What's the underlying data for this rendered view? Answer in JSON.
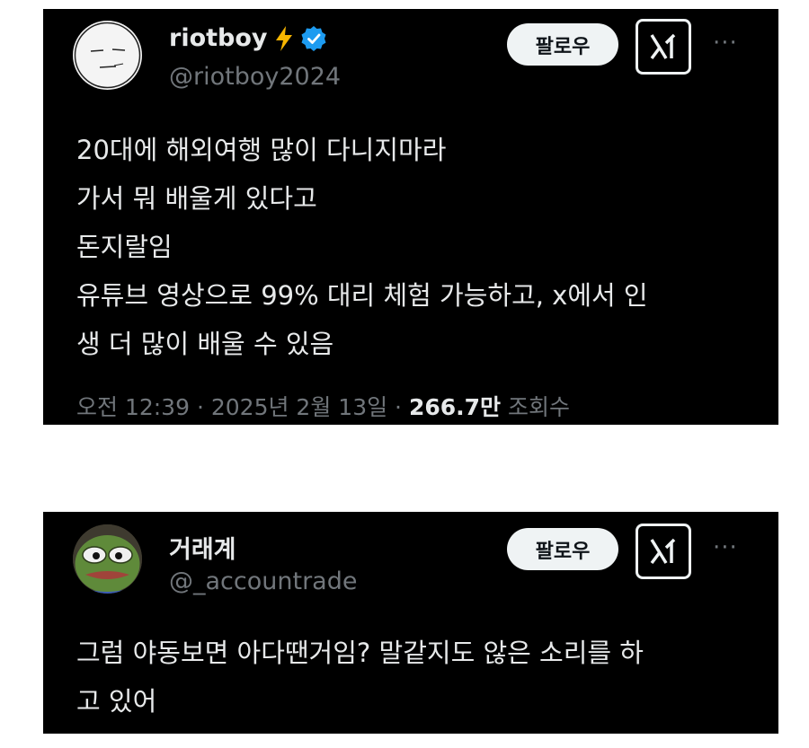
{
  "tweets": [
    {
      "display_name": "riotboy",
      "name_emoji": "⚡",
      "verified": true,
      "handle": "@riotboy2024",
      "follow_label": "팔로우",
      "lines": [
        "20대에 해외여행 많이 다니지마라",
        "가서 뭐 배울게 있다고",
        "돈지랄임",
        "유튜브 영상으로 99% 대리 체험 가능하고, x에서 인",
        "생 더 많이 배울 수 있음"
      ],
      "time": "오전 12:39",
      "sep": "·",
      "date": "2025년 2월 13일",
      "views_count": "266.7만",
      "views_label": "조회수"
    },
    {
      "display_name": "거래계",
      "handle": "@_accountrade",
      "follow_label": "팔로우",
      "lines": [
        "그럼 야동보면 아다땐거임? 말같지도 않은 소리를 하",
        "고 있어"
      ]
    }
  ],
  "icons": {
    "grok": "grok-icon",
    "more": "more-icon",
    "verified": "verified-badge-icon",
    "lightning": "lightning-emoji"
  },
  "colors": {
    "background": "#000000",
    "text": "#e7e9ea",
    "secondary": "#71767b",
    "verified_blue": "#1d9bf0",
    "button_bg": "#eff3f4"
  }
}
